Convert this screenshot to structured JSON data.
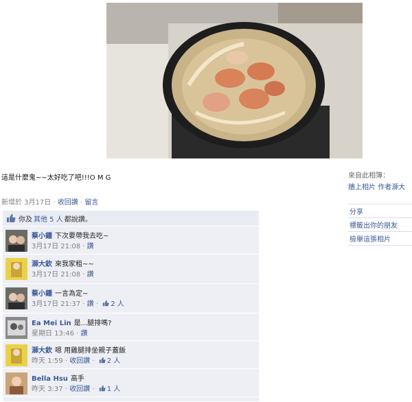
{
  "photo": {
    "alt": "pan of chicken and onion cooking"
  },
  "caption": "這是什麼鬼~~太好吃了吧!!!O M G",
  "meta": {
    "added_prefix": "新增於 3月17日",
    "sep": " · ",
    "unlike": "收回讚",
    "comment": "留言"
  },
  "likes": {
    "you_and": "你及",
    "others": "其他 5 人",
    "suffix": "都說讚。"
  },
  "comments": [
    {
      "author": "蔡小鍾",
      "text": "下次要帶我去吃~",
      "time": "3月17日 21:08",
      "action": "讚",
      "likes": ""
    },
    {
      "author": "溮大欽",
      "text": "來我家租~~",
      "time": "3月17日 21:08",
      "action": "讚",
      "likes": ""
    },
    {
      "author": "蔡小鍾",
      "text": "一言為定~",
      "time": "3月17日 21:37",
      "action": "讚",
      "likes": "2 人"
    },
    {
      "author": "Ea Mei Lin",
      "text": "是...腿排嗎?",
      "time": "星期日 13:46",
      "action": "讚",
      "likes": ""
    },
    {
      "author": "溮大欽",
      "text": "嗯 用雞腿排坐親子蓋飯",
      "time": "昨天 1:59",
      "action": "收回讚",
      "likes": "2 人"
    },
    {
      "author": "Bella Hsu",
      "text": "高手",
      "time": "昨天 3:37",
      "action": "收回讚",
      "likes": "1 人"
    }
  ],
  "sidebar": {
    "from_label": "來自此相簿：",
    "from_links": "牆上相片 作者溮大",
    "actions": [
      "分享",
      "標籤出你的朋友",
      "檢舉這張相片"
    ]
  },
  "colors": {
    "link": "#3b5998",
    "comment_bg": "#edeff4",
    "likes_bg": "#e9ecf3"
  }
}
